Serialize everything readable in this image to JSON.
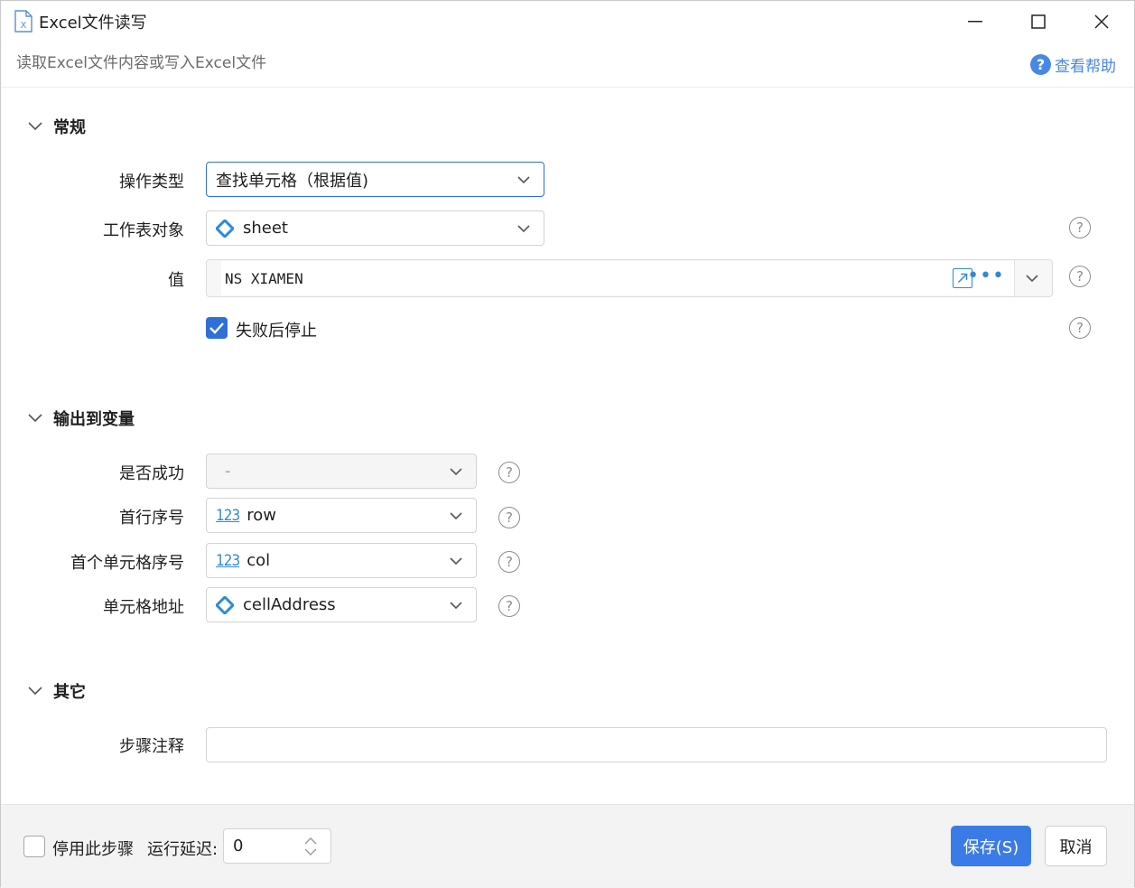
{
  "window": {
    "title": "Excel文件读写",
    "subtitle": "读取Excel文件内容或写入Excel文件",
    "help_label": "查看帮助",
    "help_glyph": "?"
  },
  "sections": {
    "general": {
      "title": "常规",
      "operation_type_label": "操作类型",
      "operation_type_value": "查找单元格（根据值)",
      "worksheet_label": "工作表对象",
      "worksheet_value": "sheet",
      "value_label": "值",
      "value_text": "NS XIAMEN",
      "stop_on_fail_label": "失败后停止",
      "stop_on_fail_checked": true
    },
    "output": {
      "title": "输出到变量",
      "success_label": "是否成功",
      "success_value": "-",
      "first_row_label": "首行序号",
      "first_row_value": "row",
      "first_cell_label": "首个单元格序号",
      "first_cell_value": "col",
      "cell_address_label": "单元格地址",
      "cell_address_value": "cellAddress",
      "number_icon_text": "123"
    },
    "other": {
      "title": "其它",
      "step_note_label": "步骤注释",
      "step_note_value": ""
    }
  },
  "footer": {
    "disable_step_label": "停用此步骤",
    "disable_step_checked": false,
    "run_delay_label": "运行延迟:",
    "run_delay_value": "0",
    "save_label": "保存(S)",
    "cancel_label": "取消"
  },
  "colors": {
    "accent": "#3b7be8",
    "link": "#4a86e8",
    "icon_blue": "#2f8ad6"
  }
}
